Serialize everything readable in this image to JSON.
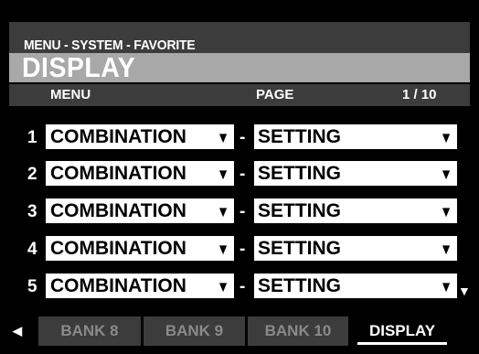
{
  "breadcrumb": "MENU - SYSTEM - FAVORITE",
  "title": "DISPLAY",
  "header": {
    "menu_label": "MENU",
    "page_label": "PAGE",
    "page_indicator": "1 / 10"
  },
  "rows": [
    {
      "number": "1",
      "menu": "COMBINATION",
      "page": "SETTING"
    },
    {
      "number": "2",
      "menu": "COMBINATION",
      "page": "SETTING"
    },
    {
      "number": "3",
      "menu": "COMBINATION",
      "page": "SETTING"
    },
    {
      "number": "4",
      "menu": "COMBINATION",
      "page": "SETTING"
    },
    {
      "number": "5",
      "menu": "COMBINATION",
      "page": "SETTING"
    }
  ],
  "separator": "-",
  "dropdown_arrow": "▼",
  "tabs": [
    {
      "label": "BANK 8",
      "selected": false
    },
    {
      "label": "BANK 9",
      "selected": false
    },
    {
      "label": "BANK 10",
      "selected": false
    },
    {
      "label": "DISPLAY",
      "selected": true
    }
  ],
  "icons": {
    "scroll_down": "▼",
    "left_arrow": "◀"
  },
  "colors": {
    "background": "#000000",
    "bar": "#3c3c3c",
    "title_bar": "#a8a8a8",
    "field": "#ffffff",
    "inactive_tab_text": "#8a8a8a"
  }
}
